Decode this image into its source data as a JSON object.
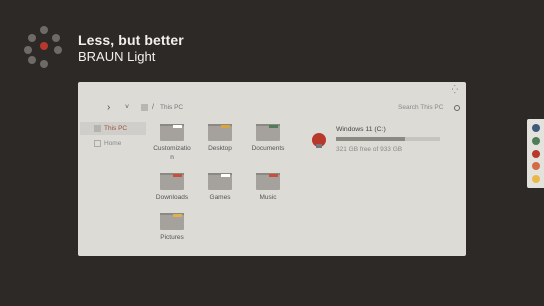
{
  "theme": {
    "headline": "Less, but better",
    "name": "BRAUN Light"
  },
  "window": {
    "breadcrumb": "This PC",
    "search_placeholder": "Search This PC",
    "sidebar": [
      {
        "label": "This PC",
        "active": true
      },
      {
        "label": "Home",
        "active": false
      }
    ],
    "folders": [
      {
        "label": "Customization",
        "accent": "#ffffff"
      },
      {
        "label": "Desktop",
        "accent": "#d9a43a"
      },
      {
        "label": "Documents",
        "accent": "#4e7d57"
      },
      {
        "label": "Downloads",
        "accent": "#c8503c"
      },
      {
        "label": "Games",
        "accent": "#ffffff"
      },
      {
        "label": "Music",
        "accent": "#c8503c"
      },
      {
        "label": "Pictures",
        "accent": "#e0b050"
      }
    ],
    "drive": {
      "name": "Windows 11 (C:)",
      "free_text": "321 GB free of 933 GB",
      "used_fraction": 0.66
    }
  },
  "palette": [
    "#3f5a7a",
    "#4e7d57",
    "#b8382c",
    "#d26b46",
    "#e8b84a"
  ],
  "colors": {
    "background": "#2c2927",
    "window": "#dcdbd6",
    "accent": "#b8382c"
  }
}
